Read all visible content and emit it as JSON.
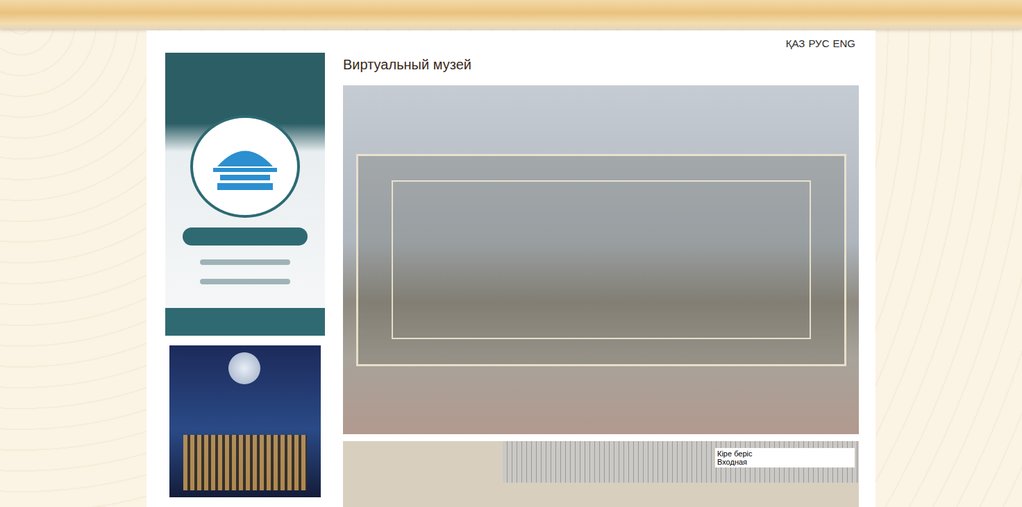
{
  "languages": [
    {
      "label": "ҚАЗ"
    },
    {
      "label": "РУС"
    },
    {
      "label": "ENG"
    }
  ],
  "page": {
    "title": "Виртуальный музей"
  },
  "tour": {
    "hotspot": [
      "Кіре беріс",
      "Входная"
    ]
  }
}
